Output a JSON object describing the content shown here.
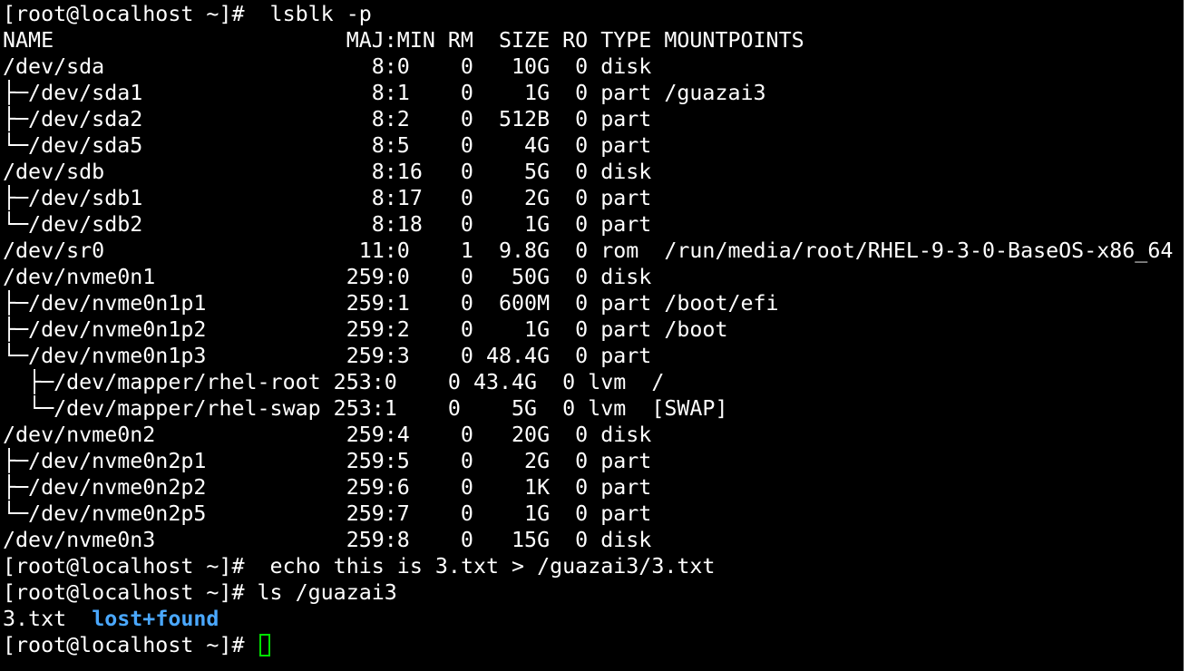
{
  "terminal": {
    "prompt": "[root@localhost ~]#",
    "commands": {
      "lsblk": "  lsblk -p",
      "echo": "  echo this is 3.txt > /guazai3/3.txt",
      "ls": " ls /guazai3",
      "current": " "
    },
    "lsblk_output": [
      "NAME                       MAJ:MIN RM  SIZE RO TYPE MOUNTPOINTS",
      "/dev/sda                     8:0    0   10G  0 disk",
      "├─/dev/sda1                  8:1    0    1G  0 part /guazai3",
      "├─/dev/sda2                  8:2    0  512B  0 part",
      "└─/dev/sda5                  8:5    0    4G  0 part",
      "/dev/sdb                     8:16   0    5G  0 disk",
      "├─/dev/sdb1                  8:17   0    2G  0 part",
      "└─/dev/sdb2                  8:18   0    1G  0 part",
      "/dev/sr0                    11:0    1  9.8G  0 rom  /run/media/root/RHEL-9-3-0-BaseOS-x86_64",
      "/dev/nvme0n1               259:0    0   50G  0 disk",
      "├─/dev/nvme0n1p1           259:1    0  600M  0 part /boot/efi",
      "├─/dev/nvme0n1p2           259:2    0    1G  0 part /boot",
      "└─/dev/nvme0n1p3           259:3    0 48.4G  0 part",
      "  ├─/dev/mapper/rhel-root 253:0    0 43.4G  0 lvm  /",
      "  └─/dev/mapper/rhel-swap 253:1    0    5G  0 lvm  [SWAP]",
      "/dev/nvme0n2               259:4    0   20G  0 disk",
      "├─/dev/nvme0n2p1           259:5    0    2G  0 part",
      "├─/dev/nvme0n2p2           259:6    0    1K  0 part",
      "└─/dev/nvme0n2p5           259:7    0    1G  0 part",
      "/dev/nvme0n3               259:8    0   15G  0 disk"
    ],
    "ls_output": {
      "file": "3.txt",
      "gap": "  ",
      "dir": "lost+found"
    },
    "colors": {
      "background": "#000000",
      "text": "#ffffff",
      "directory": "#4aa8ff",
      "cursor": "#00e000"
    }
  }
}
